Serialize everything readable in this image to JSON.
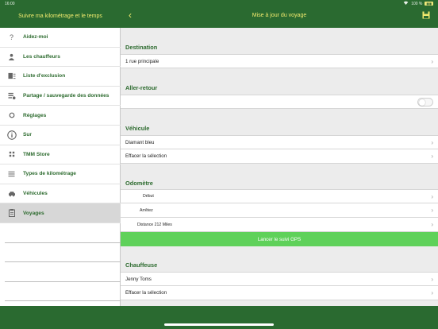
{
  "status_bar": {
    "time": "16:00",
    "battery": "100 %"
  },
  "sidebar": {
    "title": "Suivre ma kilométrage et le temps",
    "items": [
      {
        "label": "Aidez-moi",
        "icon": "help-icon"
      },
      {
        "label": "Les chauffeurs",
        "icon": "driver-icon"
      },
      {
        "label": "Liste d'exclusion",
        "icon": "exclusion-list-icon"
      },
      {
        "label": "Partage / sauvegarde des données",
        "icon": "share-backup-icon"
      },
      {
        "label": "Réglages",
        "icon": "settings-icon"
      },
      {
        "label": "Sur",
        "icon": "info-icon"
      },
      {
        "label": "TMM Store",
        "icon": "store-icon"
      },
      {
        "label": "Types de kilométrage",
        "icon": "mileage-types-icon"
      },
      {
        "label": "Véhicules",
        "icon": "vehicle-icon"
      },
      {
        "label": "Voyages",
        "icon": "trips-icon"
      }
    ]
  },
  "main": {
    "title": "Mise à jour du voyage",
    "sections": {
      "destination": "Destination",
      "aller_retour": "Aller-retour",
      "vehicule": "Véhicule",
      "odometre": "Odomètre",
      "chauffeuse": "Chauffeuse"
    },
    "destination_value": "1 rue principale",
    "vehicle_value": "Diamant bleu",
    "clear_selection": "Effacer la sélection",
    "odometer_rows": [
      "Début",
      "Arrêtez",
      "Distance  212 Miles"
    ],
    "gps_button": "Lancer le suivi GPS",
    "driver_value": "Jenny Toms",
    "round_trip": false
  }
}
